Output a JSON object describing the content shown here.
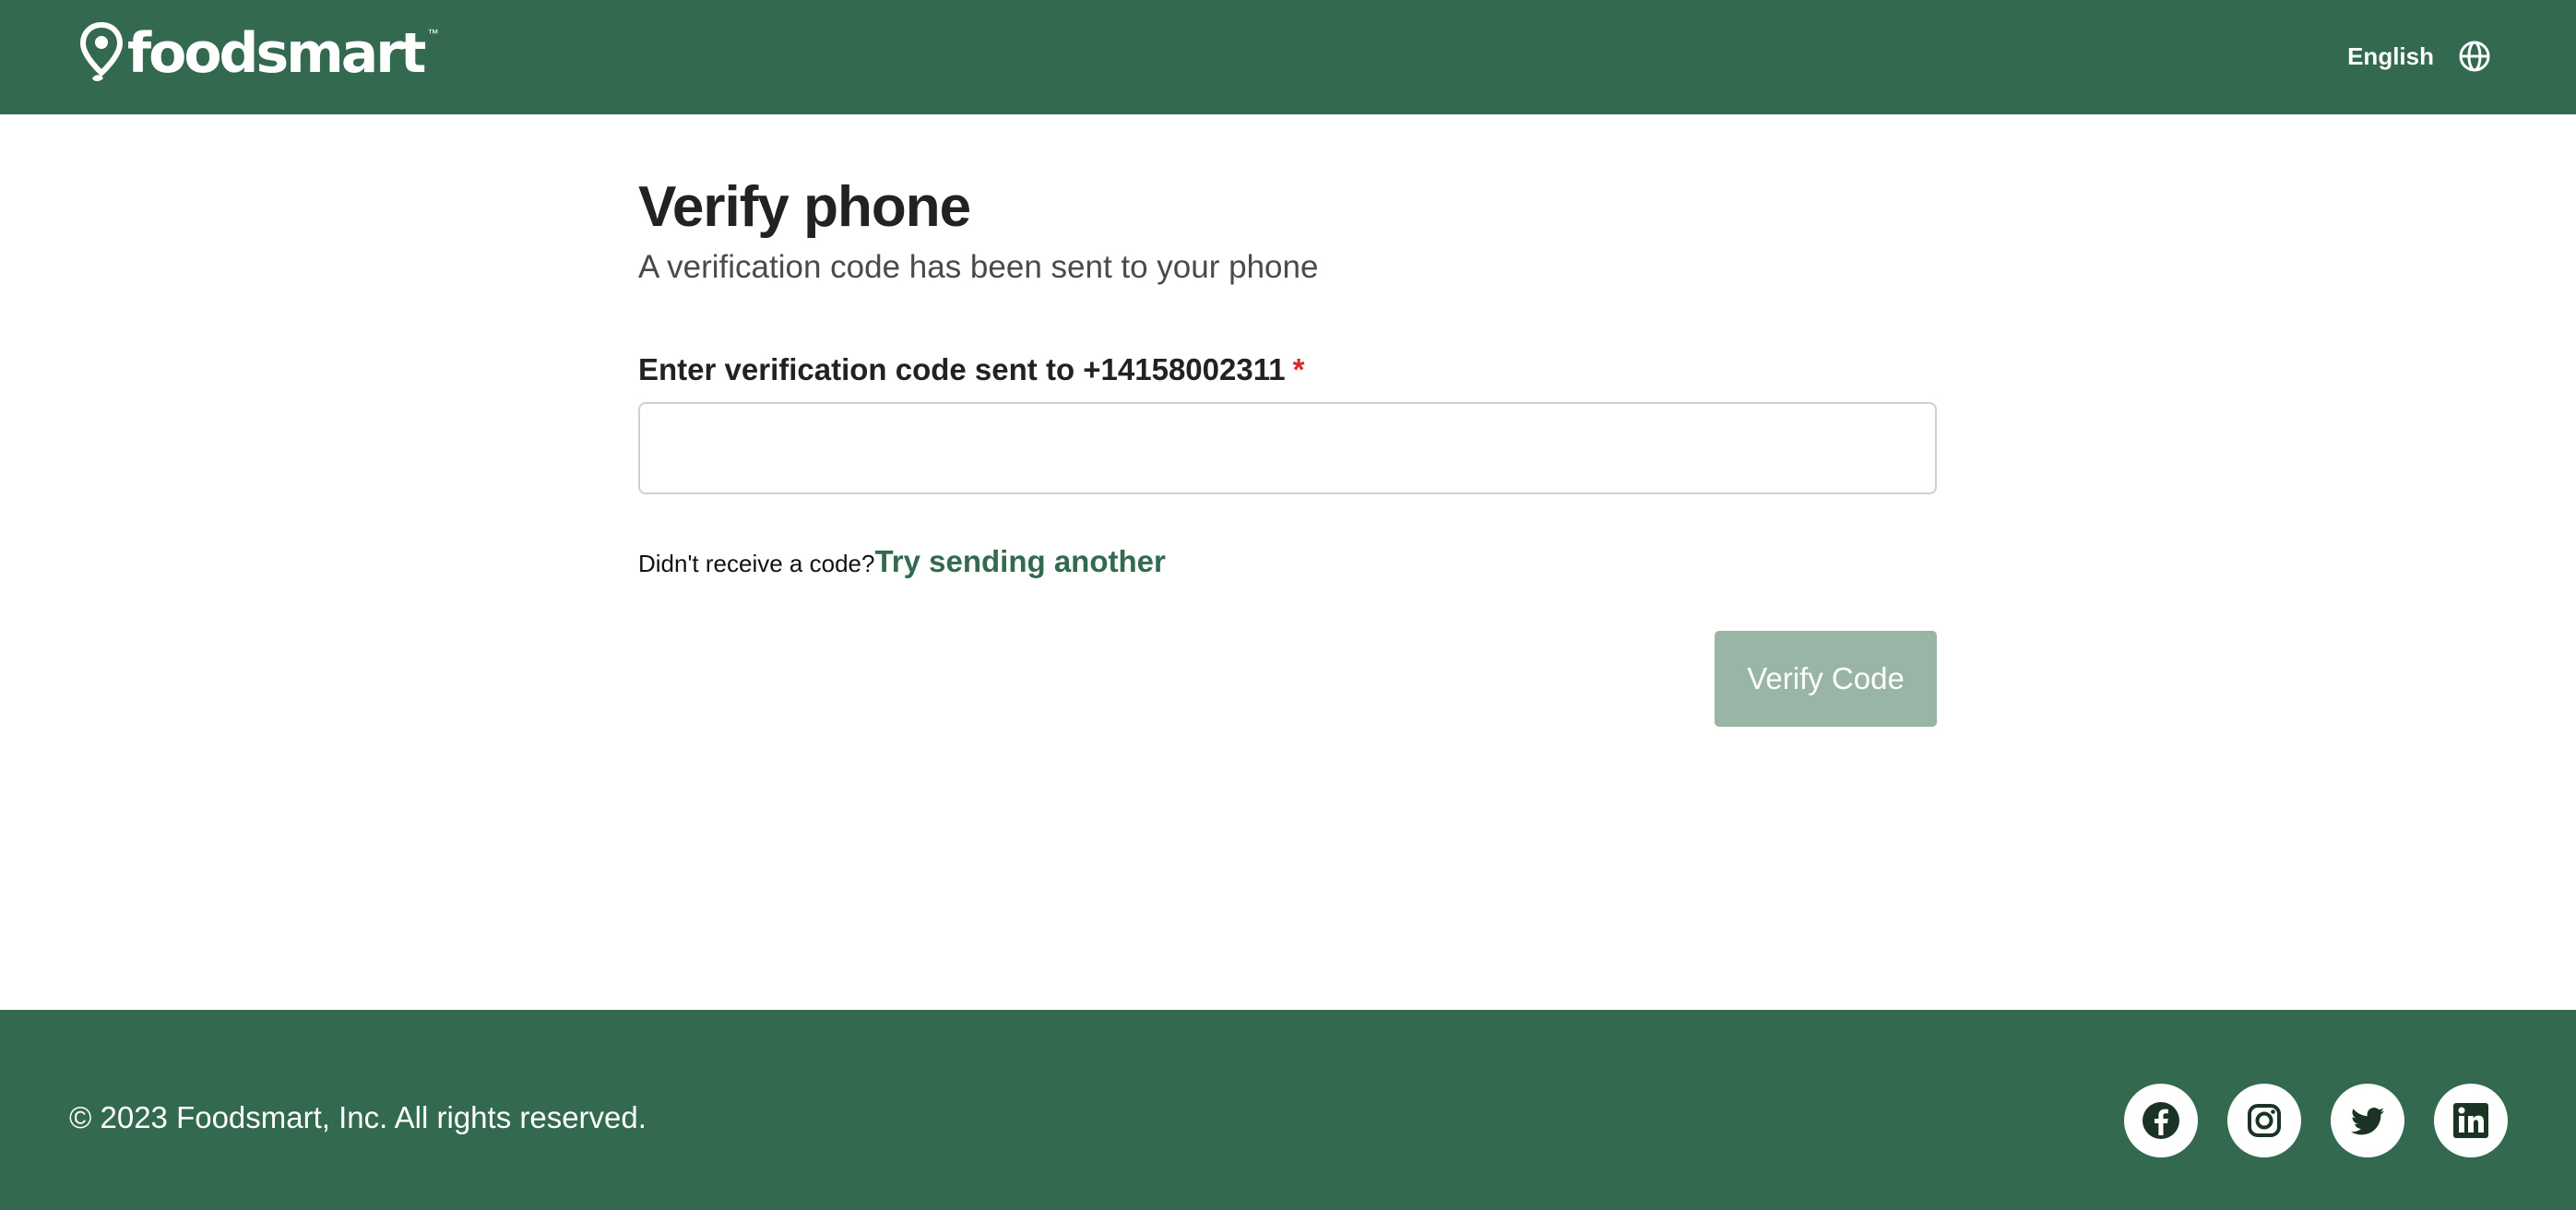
{
  "header": {
    "logo_text": "foodsmart",
    "logo_mark": "™",
    "language_label": "English",
    "language_icon": "globe-icon"
  },
  "main": {
    "title": "Verify phone",
    "subtitle": "A verification code has been sent to your phone",
    "field_label": "Enter verification code sent to +14158002311",
    "required_mark": "*",
    "code_value": "",
    "resend_prompt": "Didn't receive a code?",
    "resend_link": "Try sending another",
    "verify_button": "Verify Code"
  },
  "footer": {
    "copyright": "© 2023 Foodsmart, Inc. All rights reserved.",
    "socials": [
      "facebook-icon",
      "instagram-icon",
      "twitter-icon",
      "linkedin-icon"
    ]
  },
  "colors": {
    "brand_green": "#32694f",
    "button_disabled": "#99b5a6",
    "required_red": "#d62b2b"
  }
}
